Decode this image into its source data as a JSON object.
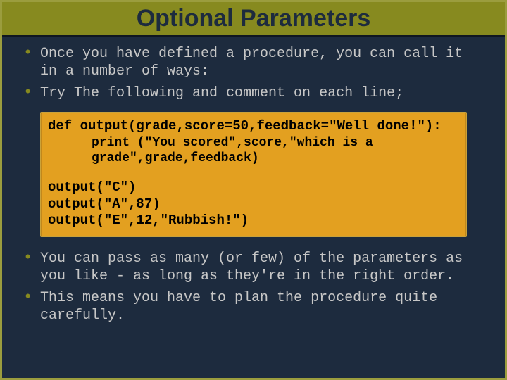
{
  "title": "Optional Parameters",
  "bullets_top": [
    "Once you have defined a procedure, you can call it in a number of ways:",
    "Try The following and comment on each line;"
  ],
  "code": {
    "def_line": "def output(grade,score=50,feedback=\"Well done!\"):",
    "print_l1": "print (\"You scored\",score,\"which is a",
    "print_l2": "grade\",grade,feedback)",
    "calls": [
      "output(\"C\")",
      "output(\"A\",87)",
      "output(\"E\",12,\"Rubbish!\")"
    ]
  },
  "bullets_bottom": [
    "You can pass as many (or few) of the parameters as you like - as long as they're in the right order.",
    "This means you have to plan the procedure quite carefully."
  ]
}
